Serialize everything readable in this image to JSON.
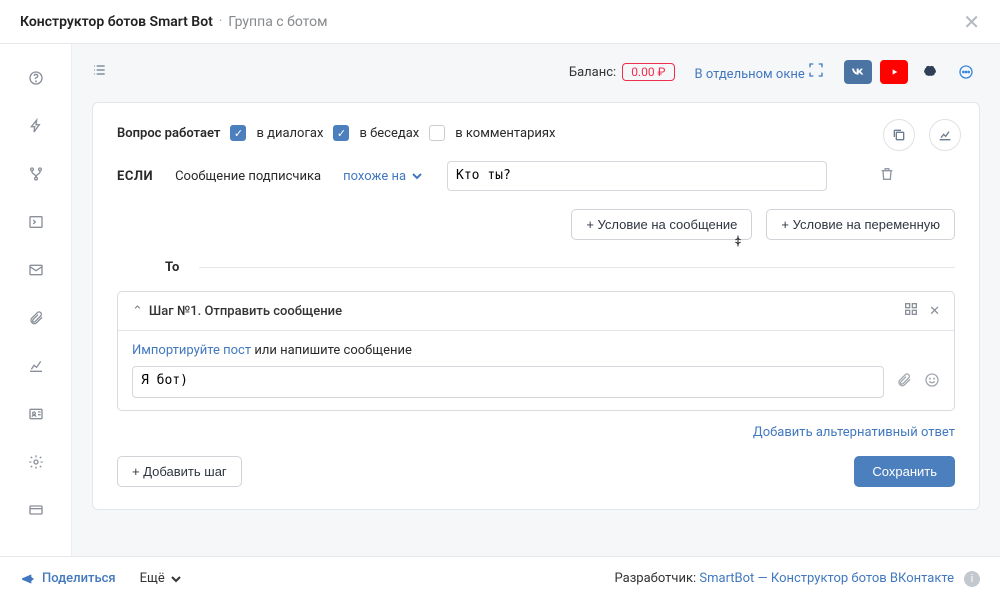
{
  "header": {
    "title": "Конструктор ботов Smart Bot",
    "sep": "·",
    "subtitle": "Группа с ботом"
  },
  "topbar": {
    "balance_label": "Баланс:",
    "balance_value": "0.00 ₽",
    "new_window": "В отдельном окне"
  },
  "cond": {
    "works_label": "Вопрос работает",
    "cb_dialogs": "в диалогах",
    "cb_chats": "в беседах",
    "cb_comments": "в комментариях",
    "if_label": "ЕСЛИ",
    "subscriber_msg": "Сообщение подписчика",
    "like": "похоже на",
    "input_value": "Кто ты?",
    "btn_msg_cond": "+ Условие на сообщение",
    "btn_var_cond": "+ Условие на переменную"
  },
  "then": {
    "label": "То"
  },
  "step": {
    "title": "Шаг №1. Отправить сообщение",
    "import_link": "Импортируйте пост",
    "import_rest": " или напишите сообщение",
    "reply_value": "Я бот)",
    "alt_answer": "Добавить альтернативный ответ"
  },
  "actions": {
    "add_step": "+ Добавить шаг",
    "save": "Сохранить"
  },
  "footer": {
    "share": "Поделиться",
    "more": "Ещё",
    "dev_label": "Разработчик: ",
    "dev_link": "SmartBot — Конструктор ботов ВКонтакте"
  }
}
